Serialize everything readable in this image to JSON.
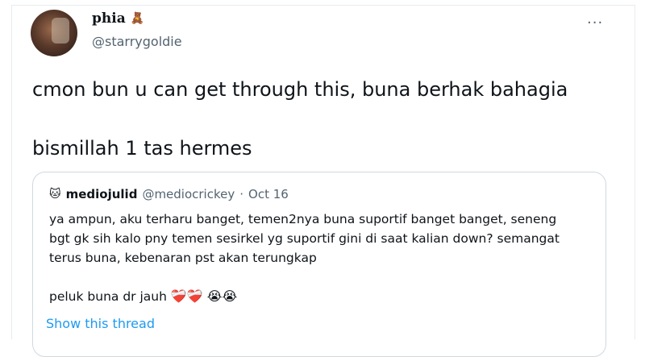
{
  "author": {
    "name": "phia",
    "badge_icon": "teddy-bear-icon",
    "badge_glyph": "🧸",
    "handle": "@starrygoldie"
  },
  "tweet": {
    "line1": "cmon bun u can get through this, buna berhak bahagia",
    "line2": "bismillah 1 tas hermes"
  },
  "quoted": {
    "avatar_glyph": "🐱",
    "name": "mediojulid",
    "handle": "@mediocrickey",
    "separator": "·",
    "date": "Oct 16",
    "lines": [
      "ya ampun, aku terharu banget, temen2nya buna suportif banget banget, seneng",
      "bgt gk sih kalo pny temen sesirkel yg suportif gini di saat kalian down? semangat",
      "terus buna, kebenaran pst akan terungkap"
    ],
    "last_line_text": "peluk buna dr jauh ",
    "emojis": "❤️‍🩹❤️‍🩹 😭😭",
    "show_thread": "Show this thread"
  },
  "more_glyph": "···",
  "colors": {
    "link": "#1d9bf0",
    "secondary": "#536471",
    "border": "#cfd9de"
  }
}
